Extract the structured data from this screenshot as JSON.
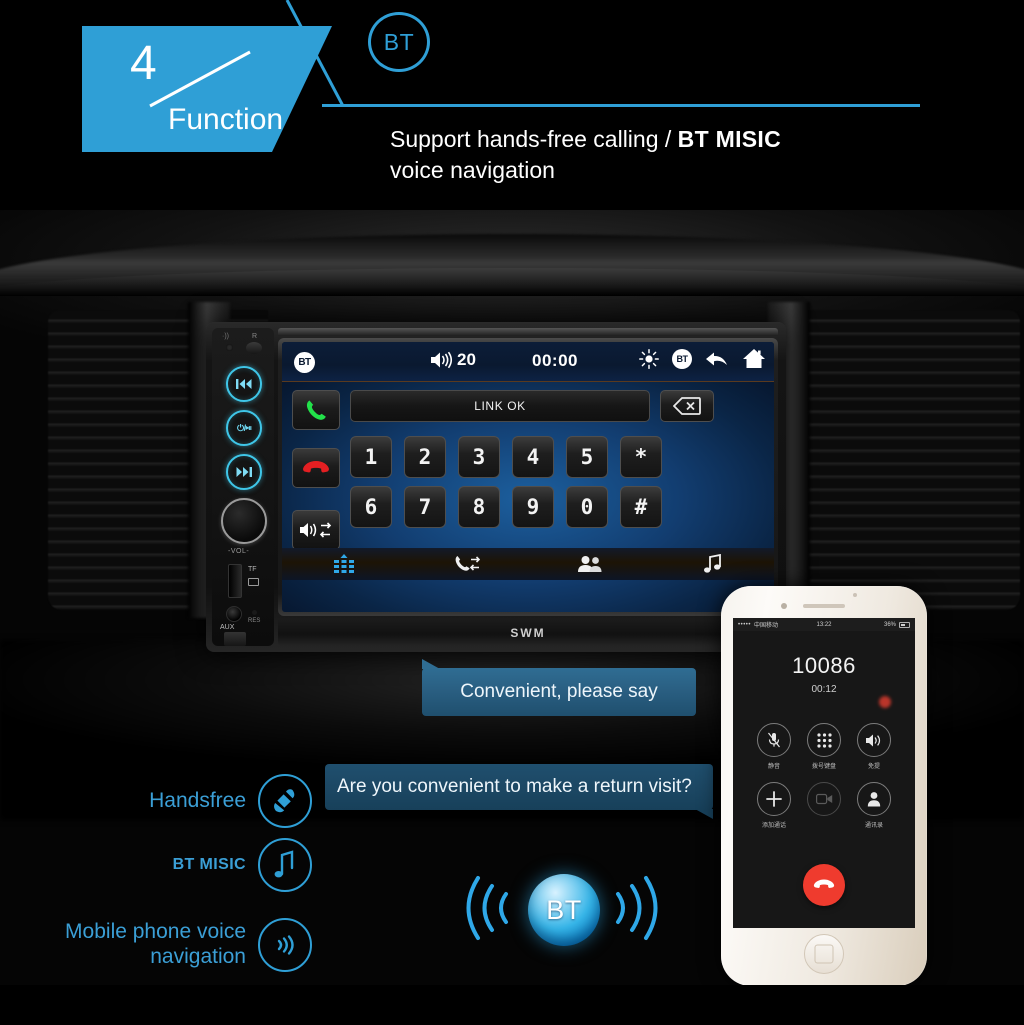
{
  "banner": {
    "tag_number": "4",
    "tag_label": "Function",
    "bt_badge": "BT",
    "headline_main": "Support hands-free calling / ",
    "headline_bold": "BT MISIC",
    "headline_second": "voice navigation",
    "accent_color": "#2f9fd6"
  },
  "head_unit": {
    "brand": "SWM",
    "side_controls": {
      "mic_label": "·))",
      "ir_label": "R",
      "prev_icon": "skip-previous-icon",
      "play_icon": "power-play-icon",
      "next_icon": "skip-next-icon",
      "play_label": "⏻/⏯",
      "volume_label": "-VOL-",
      "tf_label": "TF",
      "aux_label": "AUX",
      "res_label": "RES"
    },
    "status_bar": {
      "bt_left": "BT",
      "volume_value": "20",
      "clock": "00:00",
      "brightness_icon": "brightness-icon",
      "bt_right": "BT",
      "back_icon": "back-arrow-icon",
      "home_icon": "home-icon"
    },
    "dialer": {
      "answer_icon": "answer-call-icon",
      "hangup_icon": "end-call-icon",
      "audio_transfer_icon": "audio-transfer-icon",
      "display_value": "LINK OK",
      "delete_icon": "backspace-icon",
      "keys_row1": [
        "1",
        "2",
        "3",
        "4",
        "5",
        "*"
      ],
      "keys_row2": [
        "6",
        "7",
        "8",
        "9",
        "0",
        "#"
      ]
    },
    "toolbar": [
      {
        "name": "keypad-tab",
        "icon": "keypad-grid-icon",
        "active": true
      },
      {
        "name": "call-log-tab",
        "icon": "call-transfer-icon",
        "active": false
      },
      {
        "name": "contacts-tab",
        "icon": "contacts-icon",
        "active": false
      },
      {
        "name": "bt-music-tab",
        "icon": "music-note-icon",
        "active": false
      }
    ]
  },
  "bubbles": {
    "bubble1": "Convenient, please say",
    "bubble2": "Are you convenient to make a return visit?"
  },
  "features": [
    {
      "label": "Handsfree",
      "icon": "handset-icon"
    },
    {
      "label": "BT MISIC",
      "icon": "music-note-icon"
    },
    {
      "label": "Mobile phone voice\nnavigation",
      "icon": "sound-wave-icon"
    }
  ],
  "bt_sphere": {
    "label": "BT",
    "left_wave_icon": "wave-left-icon",
    "right_wave_icon": "wave-right-icon"
  },
  "phone": {
    "status": {
      "signal": "•••••",
      "carrier": "中国移动",
      "time": "13:22",
      "battery": "36%"
    },
    "call_number": "10086",
    "call_duration": "00:12",
    "buttons": [
      {
        "label": "静音",
        "icon": "mute-icon",
        "enabled": true
      },
      {
        "label": "拨号键盘",
        "icon": "keypad-icon",
        "enabled": true
      },
      {
        "label": "免提",
        "icon": "speaker-icon",
        "enabled": true
      },
      {
        "label": "添加通话",
        "icon": "add-call-icon",
        "enabled": true
      },
      {
        "label": "",
        "icon": "facetime-icon",
        "enabled": false
      },
      {
        "label": "通讯录",
        "icon": "contacts-icon",
        "enabled": true
      }
    ],
    "end_call_icon": "end-call-icon",
    "home_button_icon": "home-button-icon"
  }
}
